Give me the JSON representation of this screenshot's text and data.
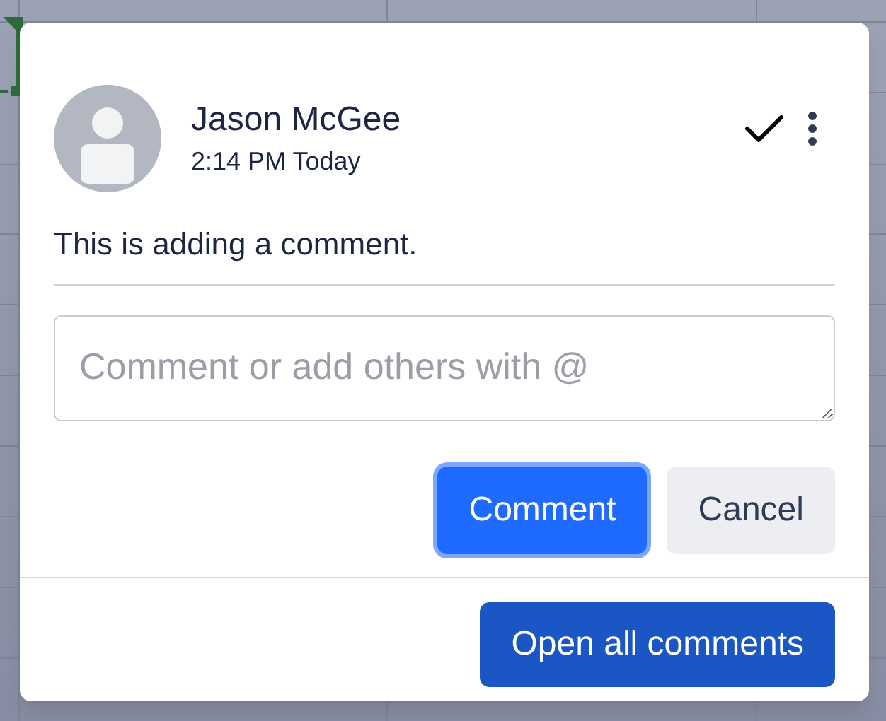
{
  "comment": {
    "author": "Jason McGee",
    "time": "2:14 PM Today",
    "text": "This is adding a comment."
  },
  "reply_field": {
    "placeholder": "Comment or add others with @"
  },
  "buttons": [
    {
      "kind": "primary",
      "label": "Comment",
      "focused": true
    },
    {
      "kind": "secondary",
      "label": "Cancel",
      "focused": false
    }
  ],
  "footer_button": {
    "label": "Open all comments"
  }
}
